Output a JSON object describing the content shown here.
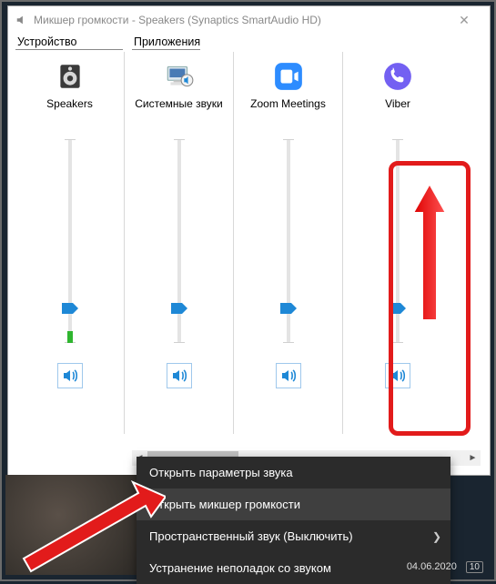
{
  "window": {
    "title": "Микшер громкости - Speakers (Synaptics SmartAudio HD)",
    "close_label": "✕"
  },
  "headers": {
    "device": "Устройство",
    "apps": "Приложения"
  },
  "device": {
    "name": "Speakers",
    "volume": 19,
    "meter": 6,
    "muted": false,
    "icon": "speaker-device-icon"
  },
  "apps": [
    {
      "name": "Системные звуки",
      "volume": 19,
      "meter": 0,
      "muted": false,
      "icon": "system-sounds-icon"
    },
    {
      "name": "Zoom Meetings",
      "volume": 19,
      "meter": 0,
      "muted": false,
      "icon": "zoom-icon"
    },
    {
      "name": "Viber",
      "volume": 19,
      "meter": 0,
      "muted": false,
      "icon": "viber-icon"
    }
  ],
  "context_menu": {
    "items": [
      {
        "label": "Открыть параметры звука",
        "submenu": false,
        "highlighted": false
      },
      {
        "label": "Открыть микшер громкости",
        "submenu": false,
        "highlighted": true
      },
      {
        "label": "Пространственный звук (Выключить)",
        "submenu": true,
        "highlighted": false
      },
      {
        "label": "Устранение неполадок со звуком",
        "submenu": false,
        "highlighted": false
      }
    ]
  },
  "tray": {
    "date": "04.06.2020",
    "notification_count": "10"
  },
  "annotations": {
    "highlight_target": "viber-slider",
    "pointer_target": "context-open-mixer"
  }
}
